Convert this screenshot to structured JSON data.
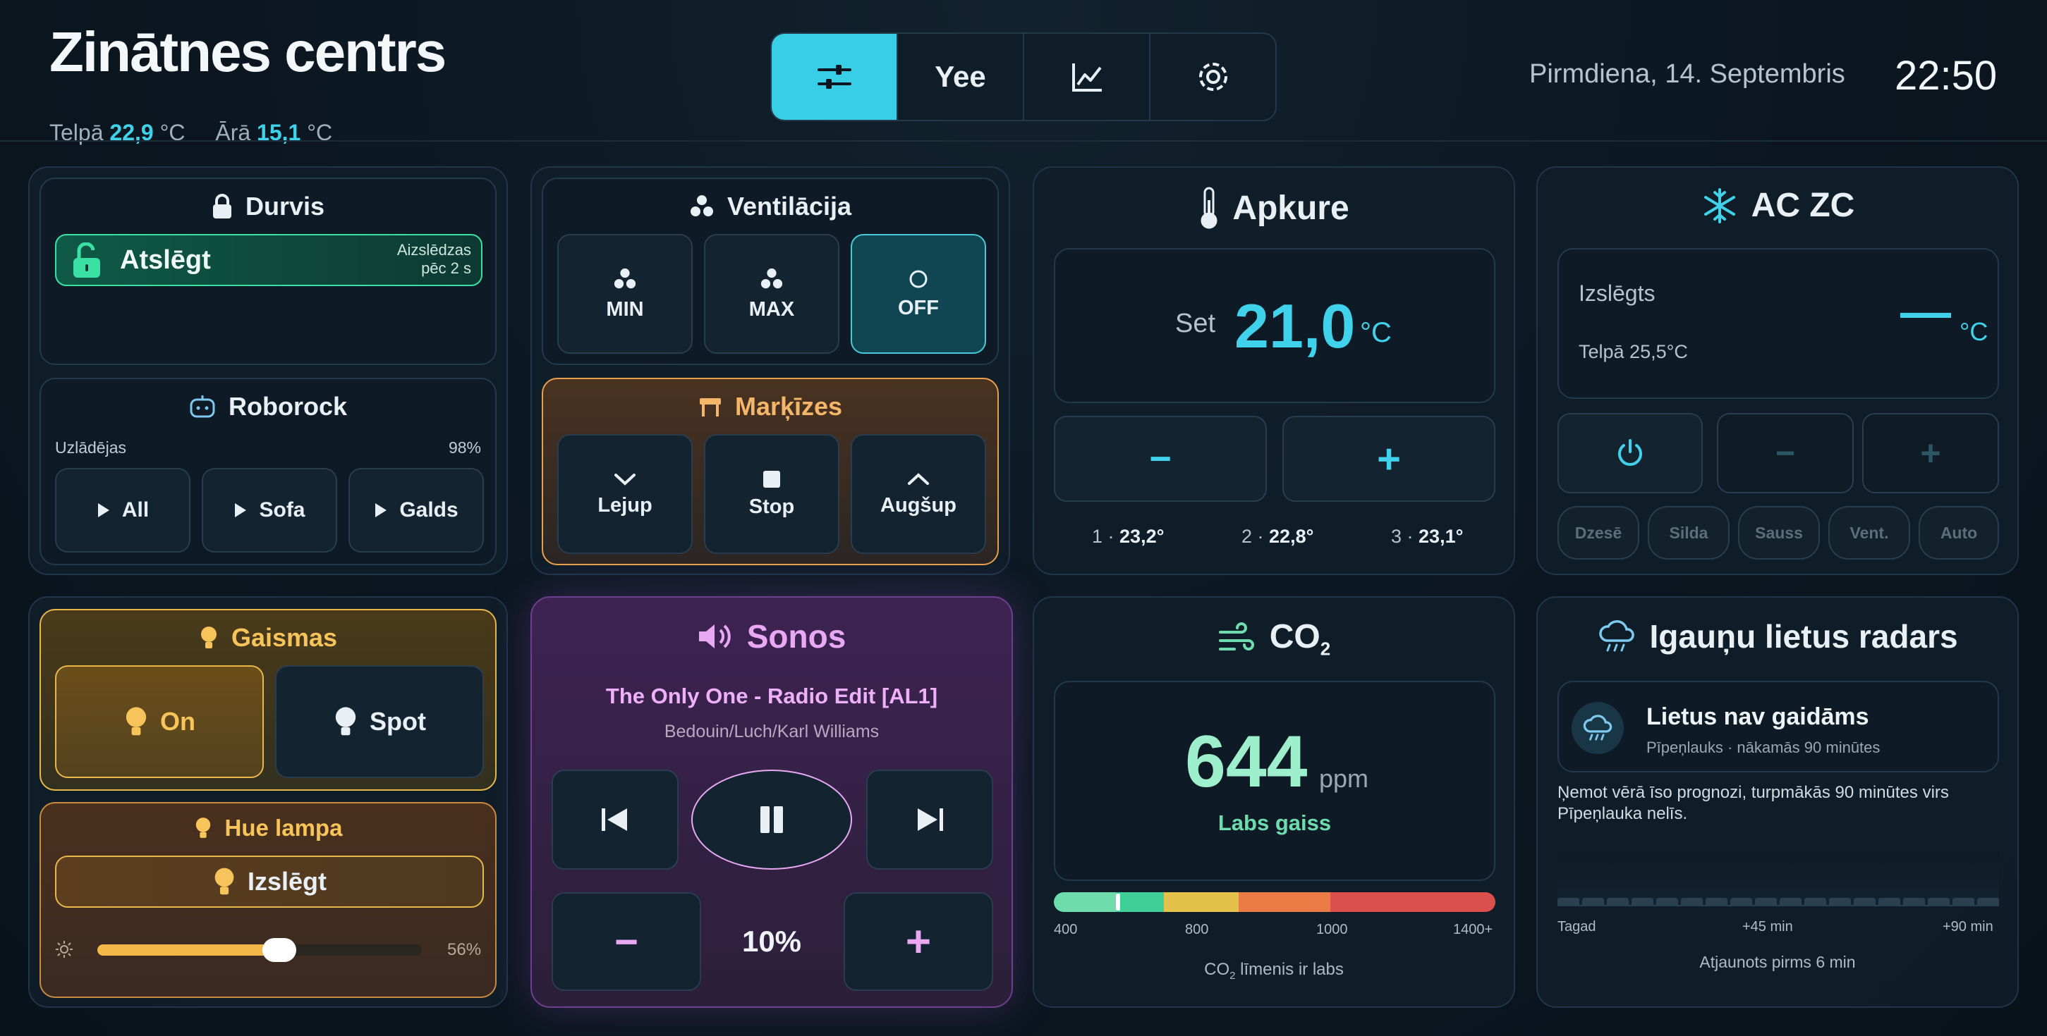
{
  "header": {
    "title": "Zinātnes centrs",
    "indoor_label": "Telpā",
    "indoor_value": "22,9",
    "outdoor_label": "Ārā",
    "outdoor_value": "15,1",
    "unit": "°C",
    "nav_yee": "Yee",
    "date": "Pirmdiena, 14. Septembris",
    "time": "22:50"
  },
  "door": {
    "title": "Durvis",
    "button_label": "Atslēgt",
    "note_line1": "Aizslēdzas",
    "note_line2": "pēc 2 s"
  },
  "roborock": {
    "title": "Roborock",
    "status": "Uzlādējas",
    "battery": "98%",
    "buttons": [
      "All",
      "Sofa",
      "Galds"
    ]
  },
  "ventilation": {
    "title": "Ventilācija",
    "buttons": [
      "MIN",
      "MAX",
      "OFF"
    ]
  },
  "markizes": {
    "title": "Marķīzes",
    "buttons": [
      "Lejup",
      "Stop",
      "Augšup"
    ]
  },
  "heating": {
    "title": "Apkure",
    "set_label": "Set",
    "set_value": "21,0",
    "unit": "°C",
    "minus": "−",
    "plus": "+",
    "zones": [
      {
        "num": "1",
        "val": "23,2°"
      },
      {
        "num": "2",
        "val": "22,8°"
      },
      {
        "num": "3",
        "val": "23,1°"
      }
    ]
  },
  "ac": {
    "title": "AC ZC",
    "state": "Izslēgts",
    "indoor": "Telpā 25,5°C",
    "value": "—",
    "unit": "°C",
    "minus": "−",
    "plus": "+",
    "modes": [
      "Dzesē",
      "Silda",
      "Sauss",
      "Vent.",
      "Auto"
    ]
  },
  "lights": {
    "title": "Gaismas",
    "buttons": [
      "On",
      "Spot"
    ]
  },
  "hue": {
    "title": "Hue lampa",
    "button_label": "Izslēgt",
    "brightness_pct": 56,
    "brightness_label": "56%"
  },
  "sonos": {
    "title": "Sonos",
    "track": "The Only One - Radio Edit [AL1]",
    "artist": "Bedouin/Luch/Karl Williams",
    "volume_minus": "−",
    "volume_plus": "+",
    "volume": "10%"
  },
  "co2": {
    "title_main": "CO",
    "title_sub": "2",
    "value": "644",
    "unit": "ppm",
    "quality": "Labs gaiss",
    "ticks": [
      "400",
      "800",
      "1000",
      "1400+"
    ],
    "footer_main": "CO",
    "footer_sub": "2",
    "footer_rest": " līmenis ir labs",
    "colors": {
      "green1": "#6fdcae",
      "green2": "#3fcf98",
      "yellow": "#e3c14b",
      "orange": "#ec7c45",
      "red": "#d9504c"
    }
  },
  "radar": {
    "title": "Igauņu lietus radars",
    "status": "Lietus nav gaidāms",
    "substatus": "Pīpeņlauks · nākamās 90 minūtes",
    "description": "Ņemot vērā īso prognozi, turpmākās 90 minūtes virs Pīpeņlauka nelīs.",
    "axis": [
      "Tagad",
      "+45 min",
      "+90 min"
    ],
    "updated": "Atjaunots pirms 6 min"
  }
}
